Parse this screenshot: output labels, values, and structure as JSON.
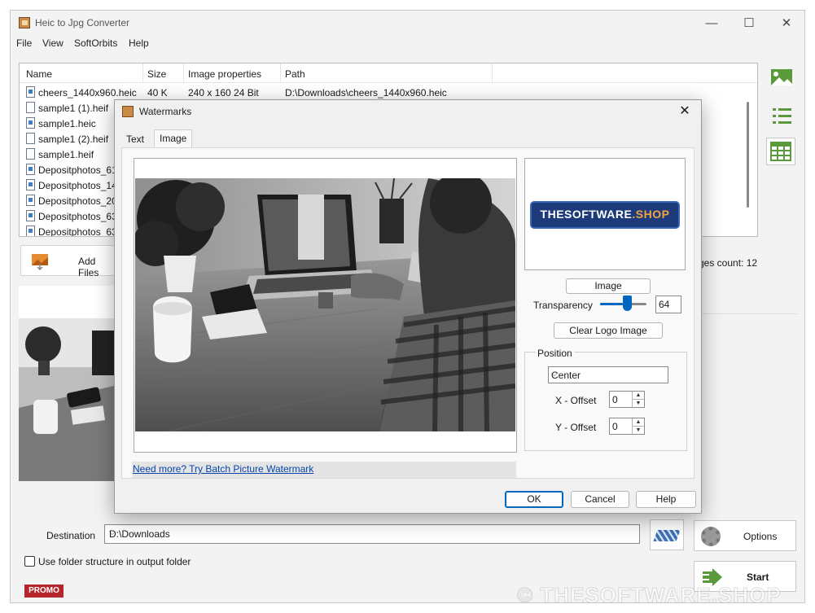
{
  "window": {
    "title": "Heic to Jpg Converter",
    "controls": {
      "minimize": "—",
      "maximize": "☐",
      "close": "✕"
    }
  },
  "menu": [
    "File",
    "View",
    "SoftOrbits",
    "Help"
  ],
  "filelist": {
    "columns": [
      "Name",
      "Size",
      "Image properties",
      "Path"
    ],
    "rows": [
      {
        "name": "cheers_1440x960.heic",
        "size": "40 K",
        "props": "240 x 160  24 Bit",
        "path": "D:\\Downloads\\cheers_1440x960.heic",
        "icon": "image-file"
      },
      {
        "name": "sample1 (1).heif",
        "size": "",
        "props": "",
        "path": "",
        "icon": "blank-file"
      },
      {
        "name": "sample1.heic",
        "size": "",
        "props": "",
        "path": "",
        "icon": "image-file"
      },
      {
        "name": "sample1 (2).heif",
        "size": "",
        "props": "",
        "path": "",
        "icon": "blank-file"
      },
      {
        "name": "sample1.heif",
        "size": "",
        "props": "",
        "path": "",
        "icon": "blank-file"
      },
      {
        "name": "Depositphotos_61",
        "size": "",
        "props": "",
        "path": "",
        "icon": "image-file"
      },
      {
        "name": "Depositphotos_14",
        "size": "",
        "props": "",
        "path": "",
        "icon": "image-file"
      },
      {
        "name": "Depositphotos_20",
        "size": "",
        "props": "",
        "path": "",
        "icon": "image-file"
      },
      {
        "name": "Depositphotos_63",
        "size": "",
        "props": "",
        "path": "",
        "icon": "image-file"
      },
      {
        "name": "Depositphotos_63",
        "size": "",
        "props": "",
        "path": "",
        "icon": "image-file"
      }
    ]
  },
  "toolbar": {
    "add_files": "Add Files",
    "images_count": "ges count: 12"
  },
  "bottom": {
    "destination_label": "Destination",
    "destination_value": "D:\\Downloads",
    "folder_structure_label": "Use folder structure in output folder",
    "options_label": "Options",
    "start_label": "Start",
    "promo": "PROMO",
    "watermark": "© THESOFTWARE.SHOP"
  },
  "dialog": {
    "title": "Watermarks",
    "close": "✕",
    "tabs": [
      "Text",
      "Image"
    ],
    "active_tab": "Image",
    "image_button": "Image",
    "transparency_label": "Transparency",
    "transparency_value": "64",
    "clear_logo_button": "Clear Logo Image",
    "position_label": "Position",
    "position_value": "Center",
    "x_offset_label": "X - Offset",
    "x_offset_value": "0",
    "y_offset_label": "Y - Offset",
    "y_offset_value": "0",
    "link_text": "Need more? Try Batch Picture Watermark",
    "logo_text_a": "THESOFTWARE",
    "logo_text_b": ".SHOP",
    "ok": "OK",
    "cancel": "Cancel",
    "help": "Help"
  },
  "colors": {
    "accent": "#0067c0",
    "promo": "#b5252c",
    "link": "#0645ad",
    "green_icon": "#5a9a3a"
  }
}
